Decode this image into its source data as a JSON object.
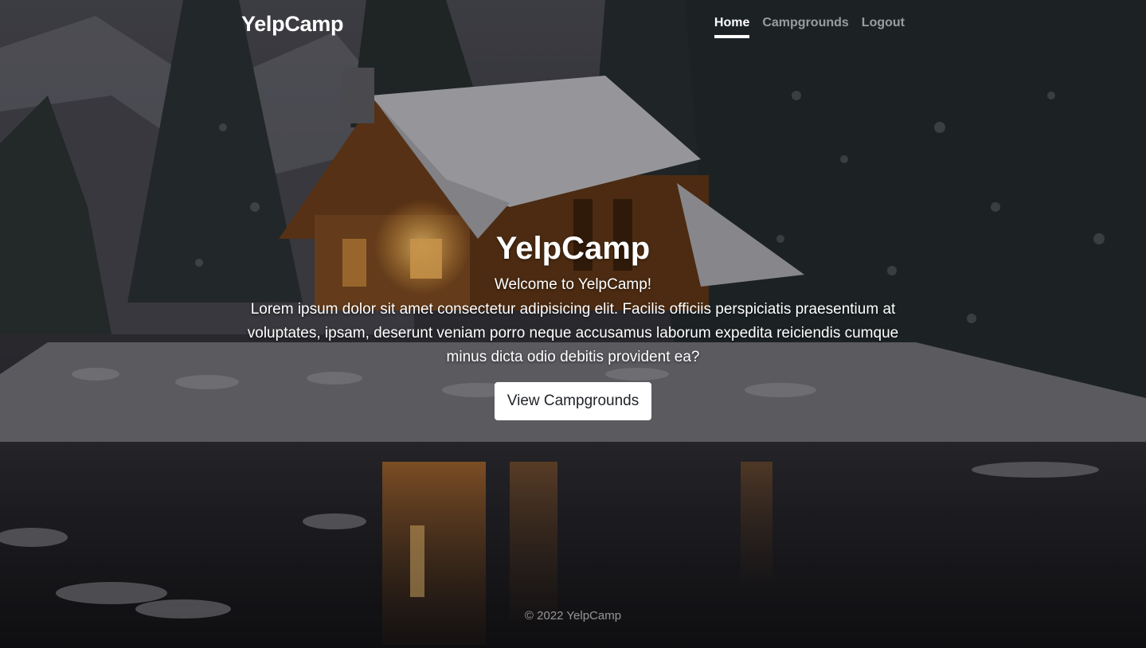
{
  "navbar": {
    "brand": "YelpCamp",
    "links": [
      {
        "label": "Home",
        "active": true
      },
      {
        "label": "Campgrounds",
        "active": false
      },
      {
        "label": "Logout",
        "active": false
      }
    ]
  },
  "hero": {
    "title": "YelpCamp",
    "welcome": "Welcome to YelpCamp!",
    "body": "Lorem ipsum dolor sit amet consectetur adipisicing elit. Facilis officiis perspiciatis praesentium at voluptates, ipsam, deserunt veniam porro neque accusamus laborum expedita reiciendis cumque minus dicta odio debitis provident ea?",
    "button_label": "View Campgrounds"
  },
  "footer": {
    "copyright": "© 2022 YelpCamp"
  },
  "background": {
    "description_icon": "winter-cabin-photo",
    "colors": {
      "sky": "#3a3a42",
      "trees": "#1c2426",
      "snow": "#8d8c92",
      "cabin_wood": "#7a4a22",
      "cabin_light": "#f3b45a",
      "water": "#18181c"
    }
  }
}
